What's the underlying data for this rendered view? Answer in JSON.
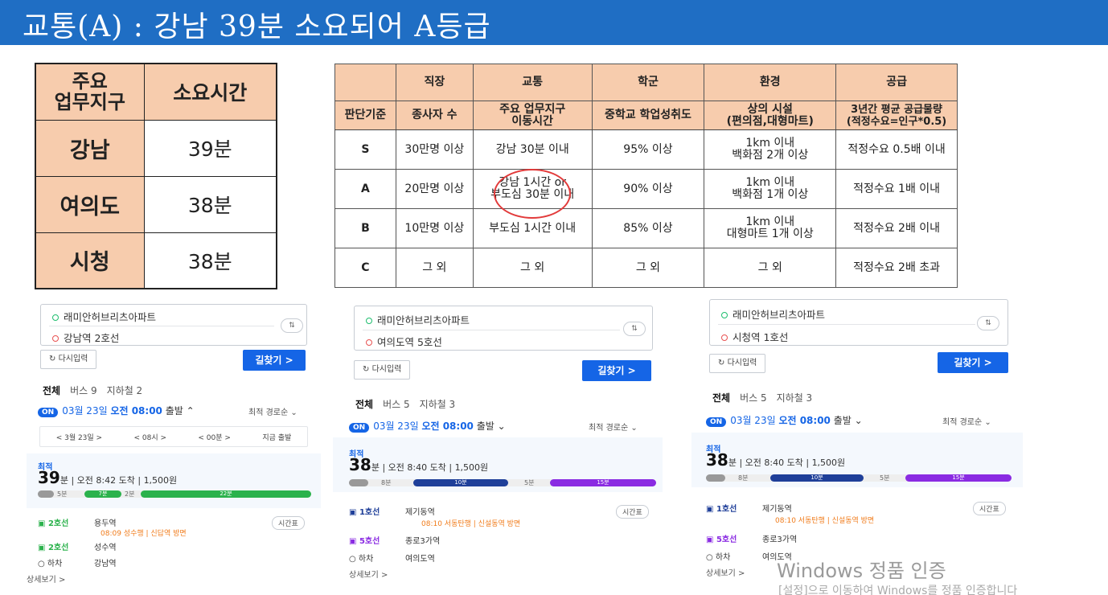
{
  "slide_title": "교통(A)  : 강남 39분 소요되어 A등급",
  "time_table": {
    "header": [
      "주요\n업무지구",
      "소요시간"
    ],
    "rows": [
      {
        "area": "강남",
        "time": "39분"
      },
      {
        "area": "여의도",
        "time": "38분"
      },
      {
        "area": "시청",
        "time": "38분"
      }
    ]
  },
  "grade_table": {
    "columns": [
      "",
      "직장",
      "교통",
      "학군",
      "환경",
      "공급"
    ],
    "criteria": [
      "판단기준",
      "종사자 수",
      "주요 업무지구\n이동시간",
      "중학교 학업성취도",
      "상의 시설\n(편의점,대형마트)",
      "3년간 평균 공급물량\n(적정수요=인구*0.5)"
    ],
    "rows": [
      {
        "grade": "S",
        "job": "30만명 이상",
        "traffic": "강남 30분 이내",
        "school": "95% 이상",
        "env": "1km 이내\n백화점 2개 이상",
        "supply": "적정수요 0.5배 이내"
      },
      {
        "grade": "A",
        "job": "20만명 이상",
        "traffic": "강남 1시간 or\n부도심 30분 이내",
        "school": "90% 이상",
        "env": "1km 이내\n백화점 1개 이상",
        "supply": "적정수요 1배 이내"
      },
      {
        "grade": "B",
        "job": "10만명 이상",
        "traffic": "부도심 1시간 이내",
        "school": "85% 이상",
        "env": "1km 이내\n대형마트 1개 이상",
        "supply": "적정수요 2배 이내"
      },
      {
        "grade": "C",
        "job": "그 외",
        "traffic": "그 외",
        "school": "그 외",
        "env": "그 외",
        "supply": "적정수요 2배 초과"
      }
    ]
  },
  "panels": [
    {
      "from": "래미안허브리츠아파트",
      "to": "강남역 2호선",
      "reset": "다시입력",
      "go": "길찾기 >",
      "tabs": [
        "전체",
        "버스 9",
        "지하철 2"
      ],
      "on": "ON",
      "date": "03월 23일",
      "time": "오전 08:00",
      "depart": "출발",
      "sort": "최적 경로순",
      "timebar": [
        "<  3월 23일  >",
        "<  08시  >",
        "<  00분  >",
        "지금 출발"
      ],
      "best": "최적",
      "minutes": "39",
      "min_unit": "분",
      "arrive": "오전 8:42 도착",
      "fare": "1,500원",
      "segs": [
        "5분",
        "7분",
        "2분",
        "22분"
      ],
      "steps": [
        {
          "line": "2호선",
          "station": "용두역",
          "sub": "08:09 성수행 | 신답역 방면"
        },
        {
          "line": "2호선",
          "station": "성수역",
          "sub": ""
        },
        {
          "line": "하차",
          "station": "강남역",
          "sub": ""
        }
      ],
      "timetable": "시간표",
      "more": "상세보기 >"
    },
    {
      "from": "래미안허브리츠아파트",
      "to": "여의도역 5호선",
      "reset": "다시입력",
      "go": "길찾기 >",
      "tabs": [
        "전체",
        "버스 5",
        "지하철 3"
      ],
      "on": "ON",
      "date": "03월 23일",
      "time": "오전 08:00",
      "depart": "출발",
      "sort": "최적 경로순",
      "best": "최적",
      "minutes": "38",
      "min_unit": "분",
      "arrive": "오전 8:40 도착",
      "fare": "1,500원",
      "segs": [
        "8분",
        "10분",
        "5분",
        "15분"
      ],
      "steps": [
        {
          "line": "1호선",
          "station": "제기동역",
          "sub": "08:10 서동탄행 | 신설동역 방면"
        },
        {
          "line": "5호선",
          "station": "종로3가역",
          "sub": ""
        },
        {
          "line": "하차",
          "station": "여의도역",
          "sub": ""
        }
      ],
      "timetable": "시간표",
      "more": "상세보기 >"
    },
    {
      "from": "래미안허브리츠아파트",
      "to": "시청역 1호선",
      "reset": "다시입력",
      "go": "길찾기 >",
      "tabs": [
        "전체",
        "버스 5",
        "지하철 3"
      ],
      "on": "ON",
      "date": "03월 23일",
      "time": "오전 08:00",
      "depart": "출발",
      "sort": "최적 경로순",
      "best": "최적",
      "minutes": "38",
      "min_unit": "분",
      "arrive": "오전 8:40 도착",
      "fare": "1,500원",
      "segs": [
        "8분",
        "10분",
        "5분",
        "15분"
      ],
      "steps": [
        {
          "line": "1호선",
          "station": "제기동역",
          "sub": "08:10 서동탄행 | 신설동역 방면"
        },
        {
          "line": "5호선",
          "station": "종로3가역",
          "sub": ""
        },
        {
          "line": "하차",
          "station": "여의도역",
          "sub": ""
        }
      ],
      "timetable": "시간표",
      "more": "상세보기 >"
    }
  ],
  "watermark": {
    "line1": "Windows 정품 인증",
    "line2": "[설정]으로 이동하여 Windows를 정품 인증합니다"
  },
  "colors": {
    "banner": "#1f6ec4",
    "header_fill": "#f7ccad",
    "accent_blue": "#1565e6",
    "line2_green": "#2bb24c",
    "line1_navy": "#1f3f99",
    "line5_purple": "#8a2be2",
    "circle_red": "#e23b3b"
  }
}
